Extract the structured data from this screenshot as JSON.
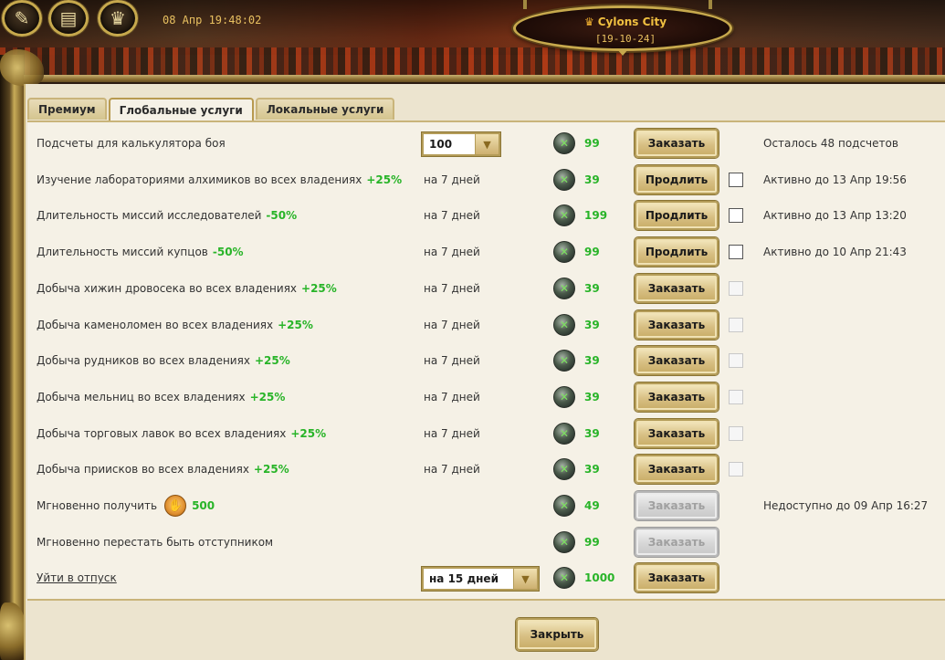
{
  "header": {
    "clock": "08 Апр 19:48:02",
    "city_name": "Cylons City",
    "city_coords": "[19-10-24]",
    "buttons": [
      {
        "icon": "quill-icon",
        "glyph": "✎"
      },
      {
        "icon": "scroll-icon",
        "glyph": "▤"
      },
      {
        "icon": "trophy-icon",
        "glyph": "♛"
      }
    ]
  },
  "tabs": [
    {
      "label": "Премиум",
      "active": false
    },
    {
      "label": "Глобальные услуги",
      "active": true
    },
    {
      "label": "Локальные услуги",
      "active": false
    }
  ],
  "colors": {
    "bonus_green": "#28b428",
    "panel_bg": "#f5f1e6",
    "gold_border": "#b49c58"
  },
  "gem_icon": "green-gem-icon",
  "rows": [
    {
      "name": "Подсчеты для калькулятора боя",
      "select": "100",
      "price": "99",
      "button": "Заказать",
      "status": "Осталось 48 подсчетов"
    },
    {
      "name": "Изучение лабораториями алхимиков во всех владениях",
      "bonus": "+25%",
      "duration": "на 7 дней",
      "price": "39",
      "button": "Продлить",
      "status": "Активно до 13 Апр 19:56"
    },
    {
      "name": "Длительность миссий исследователей",
      "bonus": "-50%",
      "duration": "на 7 дней",
      "price": "199",
      "button": "Продлить",
      "status": "Активно до 13 Апр 13:20"
    },
    {
      "name": "Длительность миссий купцов",
      "bonus": "-50%",
      "duration": "на 7 дней",
      "price": "99",
      "button": "Продлить",
      "status": "Активно до 10 Апр 21:43"
    },
    {
      "name": "Добыча хижин дровосека во всех владениях",
      "bonus": "+25%",
      "duration": "на 7 дней",
      "price": "39",
      "button": "Заказать"
    },
    {
      "name": "Добыча каменоломен во всех владениях",
      "bonus": "+25%",
      "duration": "на 7 дней",
      "price": "39",
      "button": "Заказать"
    },
    {
      "name": "Добыча рудников во всех владениях",
      "bonus": "+25%",
      "duration": "на 7 дней",
      "price": "39",
      "button": "Заказать"
    },
    {
      "name": "Добыча мельниц во всех владениях",
      "bonus": "+25%",
      "duration": "на 7 дней",
      "price": "39",
      "button": "Заказать"
    },
    {
      "name": "Добыча торговых лавок во всех владениях",
      "bonus": "+25%",
      "duration": "на 7 дней",
      "price": "39",
      "button": "Заказать"
    },
    {
      "name": "Добыча приисков во всех владениях",
      "bonus": "+25%",
      "duration": "на 7 дней",
      "price": "39",
      "button": "Заказать"
    },
    {
      "name": "Мгновенно получить",
      "bonus": "500",
      "price": "49",
      "button": "Заказать",
      "status": "Недоступно до 09 Апр 16:27"
    },
    {
      "name": "Мгновенно перестать быть отступником",
      "price": "99",
      "button": "Заказать"
    },
    {
      "name": "Уйти в отпуск",
      "select": "на 15 дней",
      "price": "1000",
      "button": "Заказать"
    }
  ],
  "footer": {
    "close_label": "Закрыть"
  }
}
